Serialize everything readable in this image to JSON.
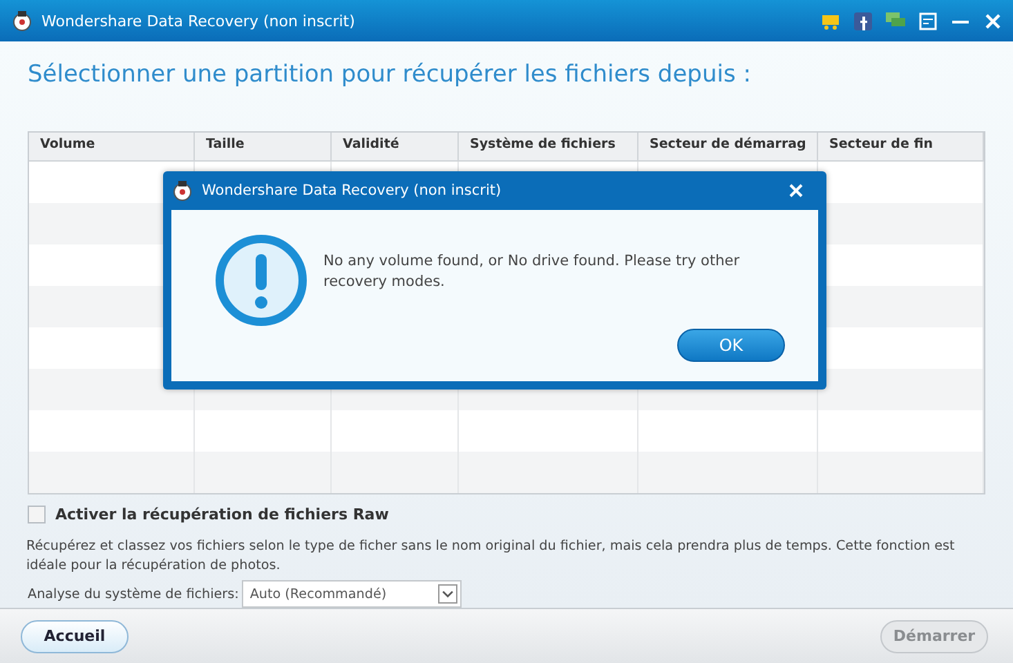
{
  "window": {
    "title": "Wondershare Data Recovery (non inscrit)"
  },
  "heading": "Sélectionner une partition pour récupérer les fichiers depuis :",
  "table": {
    "columns": [
      "Volume",
      "Taille",
      "Validité",
      "Système de fichiers",
      "Secteur de démarrag",
      "Secteur de fin"
    ]
  },
  "raw_option": {
    "label": "Activer la récupération de fichiers Raw",
    "checked": false
  },
  "description": "Récupérez et classez vos fichiers selon le type de ficher sans le nom original du fichier, mais cela prendra plus de temps. Cette fonction est idéale pour la récupération de photos.",
  "filesystem": {
    "label": "Analyse du système de fichiers:",
    "value": "Auto (Recommandé)"
  },
  "buttons": [
    {
      "label": "Accueil",
      "disabled": false
    },
    {
      "label": "Démarrer",
      "disabled": true
    }
  ],
  "dialog": {
    "title": "Wondershare Data Recovery (non inscrit)",
    "message": "No any volume found, or No drive found. Please try other recovery modes.",
    "button": "OK"
  }
}
